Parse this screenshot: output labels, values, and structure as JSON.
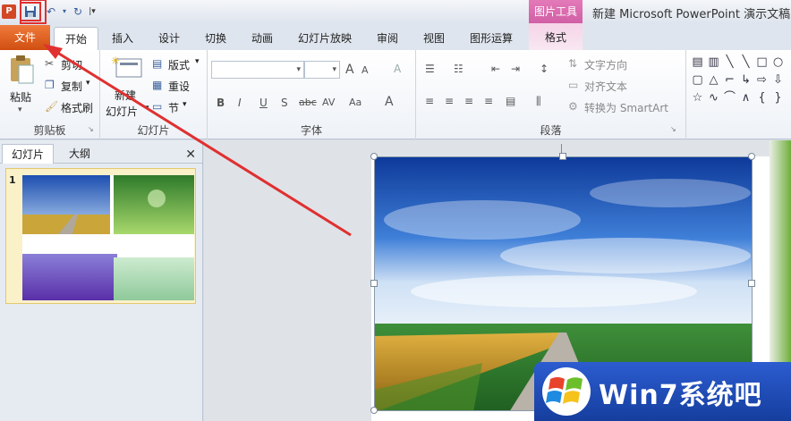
{
  "window": {
    "title": "新建 Microsoft PowerPoint 演示文稿",
    "contextual_tab_group": "图片工具"
  },
  "quick_access": {
    "app_icon": "powerpoint-logo",
    "app_icon_letter": "P",
    "items": [
      "save-icon",
      "undo-icon",
      "redo-icon",
      "customize-icon"
    ]
  },
  "tabs": {
    "file": "文件",
    "home": "开始",
    "insert": "插入",
    "design": "设计",
    "transitions": "切换",
    "animations": "动画",
    "slideshow": "幻灯片放映",
    "review": "审阅",
    "view": "视图",
    "shape_ops": "图形运算",
    "format": "格式"
  },
  "ribbon": {
    "clipboard": {
      "paste": "粘贴",
      "cut": "剪切",
      "copy": "复制",
      "format_painter": "格式刷",
      "label": "剪贴板"
    },
    "slides": {
      "new_slide": "新建",
      "new_slide_2": "幻灯片",
      "layout": "版式",
      "reset": "重设",
      "section": "节",
      "label": "幻灯片"
    },
    "font": {
      "label": "字体",
      "font_size_up": "A",
      "font_size_down": "A",
      "clear": "A",
      "bold": "B",
      "italic": "I",
      "underline": "U",
      "shadow": "S",
      "strike": "abc",
      "spacing": "AV",
      "case": "Aa",
      "color": "A"
    },
    "paragraph": {
      "label": "段落",
      "text_direction": "文字方向",
      "align_text": "对齐文本",
      "convert_smartart": "转换为 SmartArt"
    }
  },
  "left_pane": {
    "tab_slides": "幻灯片",
    "tab_outline": "大纲",
    "close": "✕",
    "slide_number": "1"
  },
  "watermark": {
    "text": "Win7系统吧"
  },
  "colors": {
    "file_tab": "#d04f10",
    "picture_tools": "#d15ea5",
    "annotation": "#e03030",
    "watermark_bg": "#1e4ab8"
  }
}
